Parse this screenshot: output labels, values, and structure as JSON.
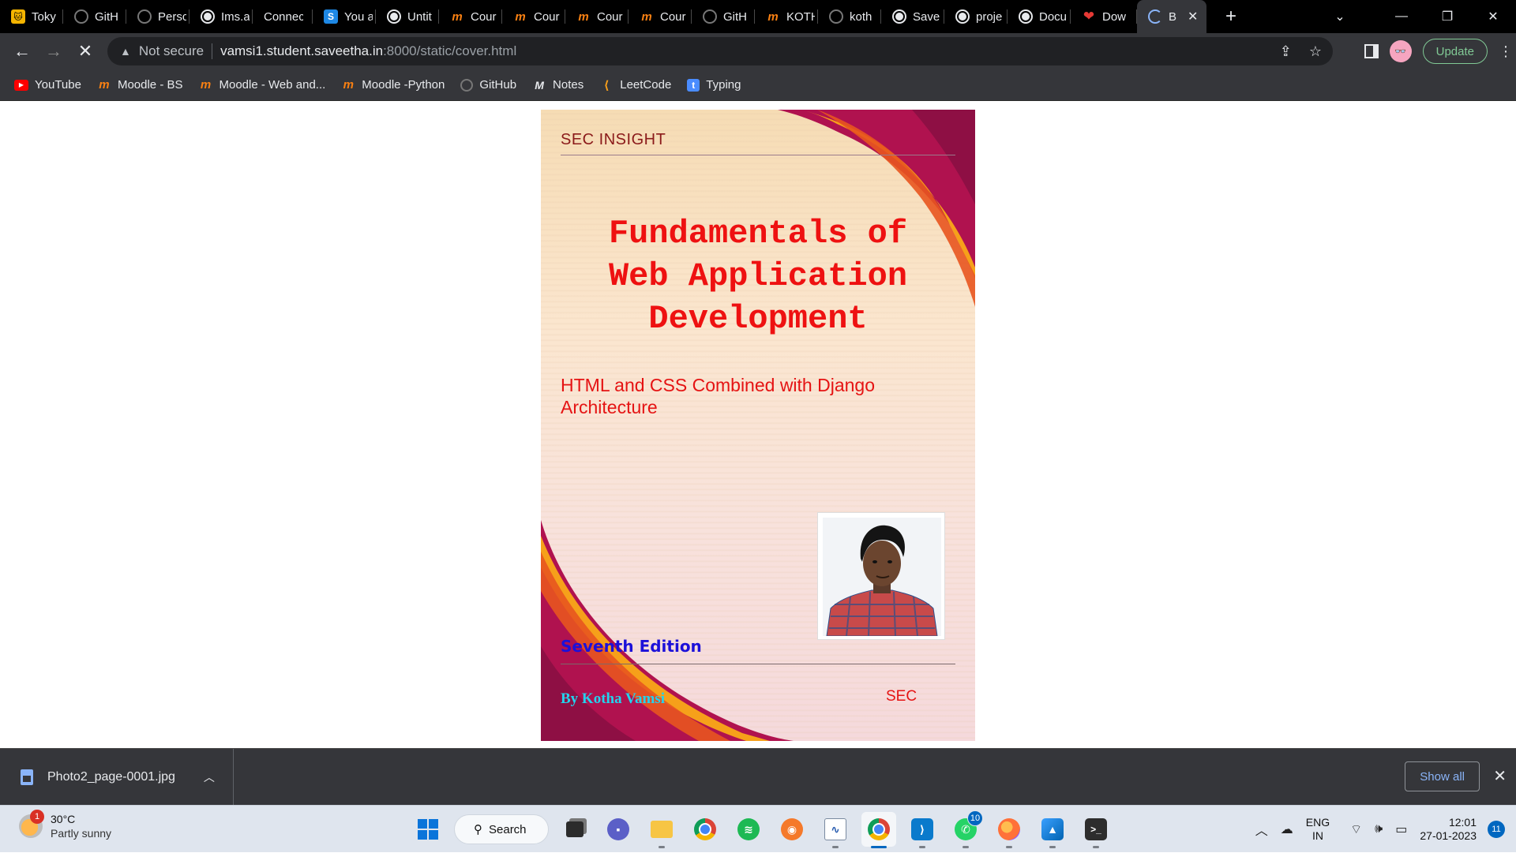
{
  "browser": {
    "tabs": [
      {
        "title": "Toky",
        "icon": "cat-icon"
      },
      {
        "title": "GitH",
        "icon": "github-icon"
      },
      {
        "title": "Persc",
        "icon": "github-icon"
      },
      {
        "title": "Ims.a",
        "icon": "globe-icon"
      },
      {
        "title": "Connect",
        "icon": "none"
      },
      {
        "title": "You a",
        "icon": "s-icon"
      },
      {
        "title": "Untit",
        "icon": "globe-icon"
      },
      {
        "title": "Cour",
        "icon": "moodle-icon"
      },
      {
        "title": "Cour",
        "icon": "moodle-icon"
      },
      {
        "title": "Cour",
        "icon": "moodle-icon"
      },
      {
        "title": "Cour",
        "icon": "moodle-icon"
      },
      {
        "title": "GitH",
        "icon": "github-icon"
      },
      {
        "title": "KOTH",
        "icon": "moodle-icon"
      },
      {
        "title": "koth",
        "icon": "github-icon"
      },
      {
        "title": "Save",
        "icon": "globe-icon"
      },
      {
        "title": "proje",
        "icon": "globe-icon"
      },
      {
        "title": "Docu",
        "icon": "globe-icon"
      },
      {
        "title": "Dow",
        "icon": "heart-icon"
      }
    ],
    "active_tab": {
      "title": "B",
      "icon": "loading-spinner-icon"
    },
    "new_tab_glyph": "+",
    "window_controls": {
      "minimize": "—",
      "restore": "❐",
      "close": "✕",
      "tab_search": "⌄"
    },
    "address_bar": {
      "security_label": "Not secure",
      "url_host": "vamsi1.student.saveetha.in",
      "url_rest": ":8000/static/cover.html"
    },
    "update_label": "Update",
    "profile_initials": "👓",
    "bookmarks": [
      {
        "label": "YouTube",
        "icon": "youtube-icon"
      },
      {
        "label": "Moodle - BS",
        "icon": "moodle-icon"
      },
      {
        "label": "Moodle - Web and...",
        "icon": "moodle-icon"
      },
      {
        "label": "Moodle -Python",
        "icon": "moodle-icon"
      },
      {
        "label": "GitHub",
        "icon": "github-icon"
      },
      {
        "label": "Notes",
        "icon": "notes-icon"
      },
      {
        "label": "LeetCode",
        "icon": "leetcode-icon"
      },
      {
        "label": "Typing",
        "icon": "typing-icon"
      }
    ]
  },
  "page": {
    "brand": "SEC INSIGHT",
    "title_lines": [
      "Fundamentals of",
      "Web Application",
      "Development"
    ],
    "subtitle_lines": [
      "HTML and CSS Combined with Django",
      "Architecture"
    ],
    "edition": "Seventh Edition",
    "author": "By Kotha Vamsi",
    "org": "SEC",
    "colors": {
      "title": "#ee1111",
      "edition": "#1c10d9",
      "author": "#22d3ee",
      "swoosh_dark": "#b0124f",
      "swoosh_gold": "#f6a01a"
    }
  },
  "downloads": {
    "file_name": "Photo2_page-0001.jpg",
    "show_all_label": "Show all",
    "close_glyph": "✕"
  },
  "taskbar": {
    "weather_temp": "30°C",
    "weather_condition": "Partly sunny",
    "weather_badge": "1",
    "search_label": "Search",
    "whatsapp_badge": "10",
    "language_top": "ENG",
    "language_bottom": "IN",
    "time": "12:01",
    "date": "27-01-2023",
    "notification_count": "11"
  }
}
